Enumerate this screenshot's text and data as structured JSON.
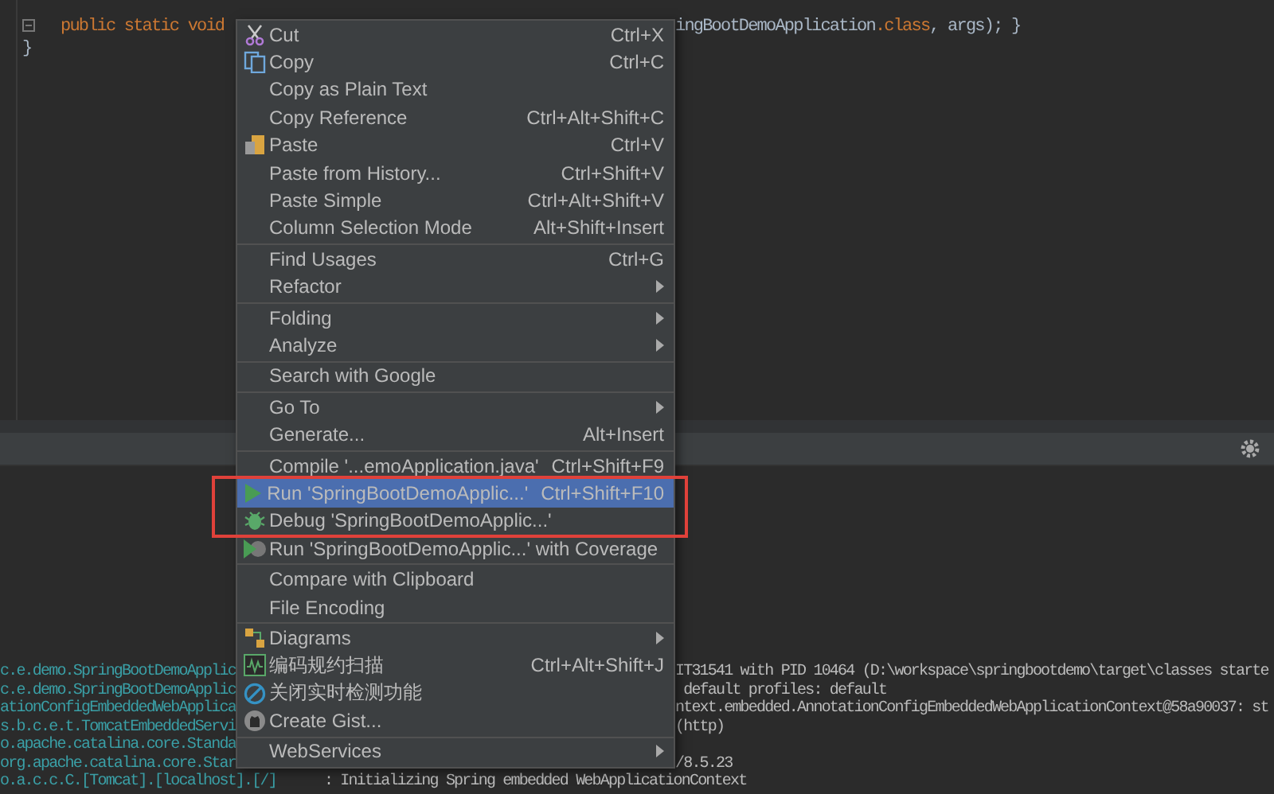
{
  "editor": {
    "lines": [
      {
        "kind": "statement",
        "parts": [
          {
            "kind": "keyword",
            "text": "public static void"
          }
        ],
        "after_menu": [
          {
            "kind": "plain",
            "text": "ingBootDemoApplication"
          },
          {
            "kind": "keyword",
            "text": ".class"
          },
          {
            "kind": "plain",
            "text": ", args); }"
          }
        ]
      },
      {
        "kind": "closing",
        "parts": [
          {
            "kind": "plain",
            "text": "}"
          }
        ]
      }
    ]
  },
  "context_menu": {
    "groups": [
      [
        {
          "label": "Cut",
          "shortcut": "Ctrl+X",
          "kind": "cut",
          "submenu": false,
          "selected": false
        },
        {
          "label": "Copy",
          "shortcut": "Ctrl+C",
          "kind": "copy",
          "submenu": false,
          "selected": false
        },
        {
          "label": "Copy as Plain Text",
          "submenu": false,
          "selected": false
        },
        {
          "label": "Copy Reference",
          "shortcut": "Ctrl+Alt+Shift+C",
          "submenu": false,
          "selected": false
        },
        {
          "label": "Paste",
          "shortcut": "Ctrl+V",
          "kind": "paste",
          "submenu": false,
          "selected": false
        },
        {
          "label": "Paste from History...",
          "shortcut": "Ctrl+Shift+V",
          "submenu": false,
          "selected": false
        },
        {
          "label": "Paste Simple",
          "shortcut": "Ctrl+Alt+Shift+V",
          "submenu": false,
          "selected": false
        },
        {
          "label": "Column Selection Mode",
          "shortcut": "Alt+Shift+Insert",
          "submenu": false,
          "selected": false
        }
      ],
      [
        {
          "label": "Find Usages",
          "shortcut": "Ctrl+G",
          "submenu": false,
          "selected": false
        },
        {
          "label": "Refactor",
          "submenu": true,
          "selected": false
        }
      ],
      [
        {
          "label": "Folding",
          "submenu": true,
          "selected": false
        },
        {
          "label": "Analyze",
          "submenu": true,
          "selected": false
        }
      ],
      [
        {
          "label": "Search with Google",
          "submenu": false,
          "selected": false
        }
      ],
      [
        {
          "label": "Go To",
          "submenu": true,
          "selected": false
        },
        {
          "label": "Generate...",
          "shortcut": "Alt+Insert",
          "submenu": false,
          "selected": false
        }
      ],
      [
        {
          "label": "Compile '...emoApplication.java'",
          "shortcut": "Ctrl+Shift+F9",
          "submenu": false,
          "selected": false
        },
        {
          "kind": "highlight_box",
          "items": [
            {
              "label": "Run 'SpringBootDemoApplic...'",
              "shortcut": "Ctrl+Shift+F10",
              "kind": "run",
              "submenu": false,
              "selected": true
            },
            {
              "label": "Debug 'SpringBootDemoApplic...'",
              "kind": "debug",
              "submenu": false,
              "selected": false
            }
          ]
        },
        {
          "label": "Run 'SpringBootDemoApplic...' with Coverage",
          "kind": "coverage",
          "submenu": false,
          "selected": false
        }
      ],
      [
        {
          "label": "Compare with Clipboard",
          "submenu": false,
          "selected": false
        },
        {
          "label": "File Encoding",
          "submenu": false,
          "selected": false
        }
      ],
      [
        {
          "label": "Diagrams",
          "kind": "diagrams",
          "submenu": true,
          "selected": false
        },
        {
          "label": "编码规约扫描",
          "shortcut": "Ctrl+Alt+Shift+J",
          "kind": "scan",
          "submenu": false,
          "selected": false
        },
        {
          "label": "关闭实时检测功能",
          "kind": "block",
          "submenu": false,
          "selected": false
        },
        {
          "label": "Create Gist...",
          "kind": "gist",
          "submenu": false,
          "selected": false
        }
      ],
      [
        {
          "label": "WebServices",
          "submenu": true,
          "selected": false
        }
      ]
    ]
  },
  "console": {
    "rows": [
      {
        "kind": "split",
        "source": "c.e.demo.SpringBootDemoApplic",
        "message": "IT31541 with PID 10464 (D:\\workspace\\springbootdemo\\target\\classes starte"
      },
      {
        "kind": "split",
        "source": "c.e.demo.SpringBootDemoApplic",
        "message": " default profiles: default"
      },
      {
        "kind": "split",
        "source": "ationConfigEmbeddedWebApplica",
        "message": "ntext.embedded.AnnotationConfigEmbeddedWebApplicationContext@58a90037: st"
      },
      {
        "kind": "split",
        "source": "s.b.c.e.t.TomcatEmbeddedServi",
        "message": "(http)"
      },
      {
        "kind": "split",
        "source": "o.apache.catalina.core.Standa"
      },
      {
        "kind": "split",
        "source": "org.apache.catalina.core.Star",
        "message": "/8.5.23"
      },
      {
        "kind": "whole",
        "source": "o.a.c.c.C.[Tomcat].[localhost].[/]",
        "message": ": Initializing Spring embedded WebApplicationContext"
      }
    ]
  }
}
